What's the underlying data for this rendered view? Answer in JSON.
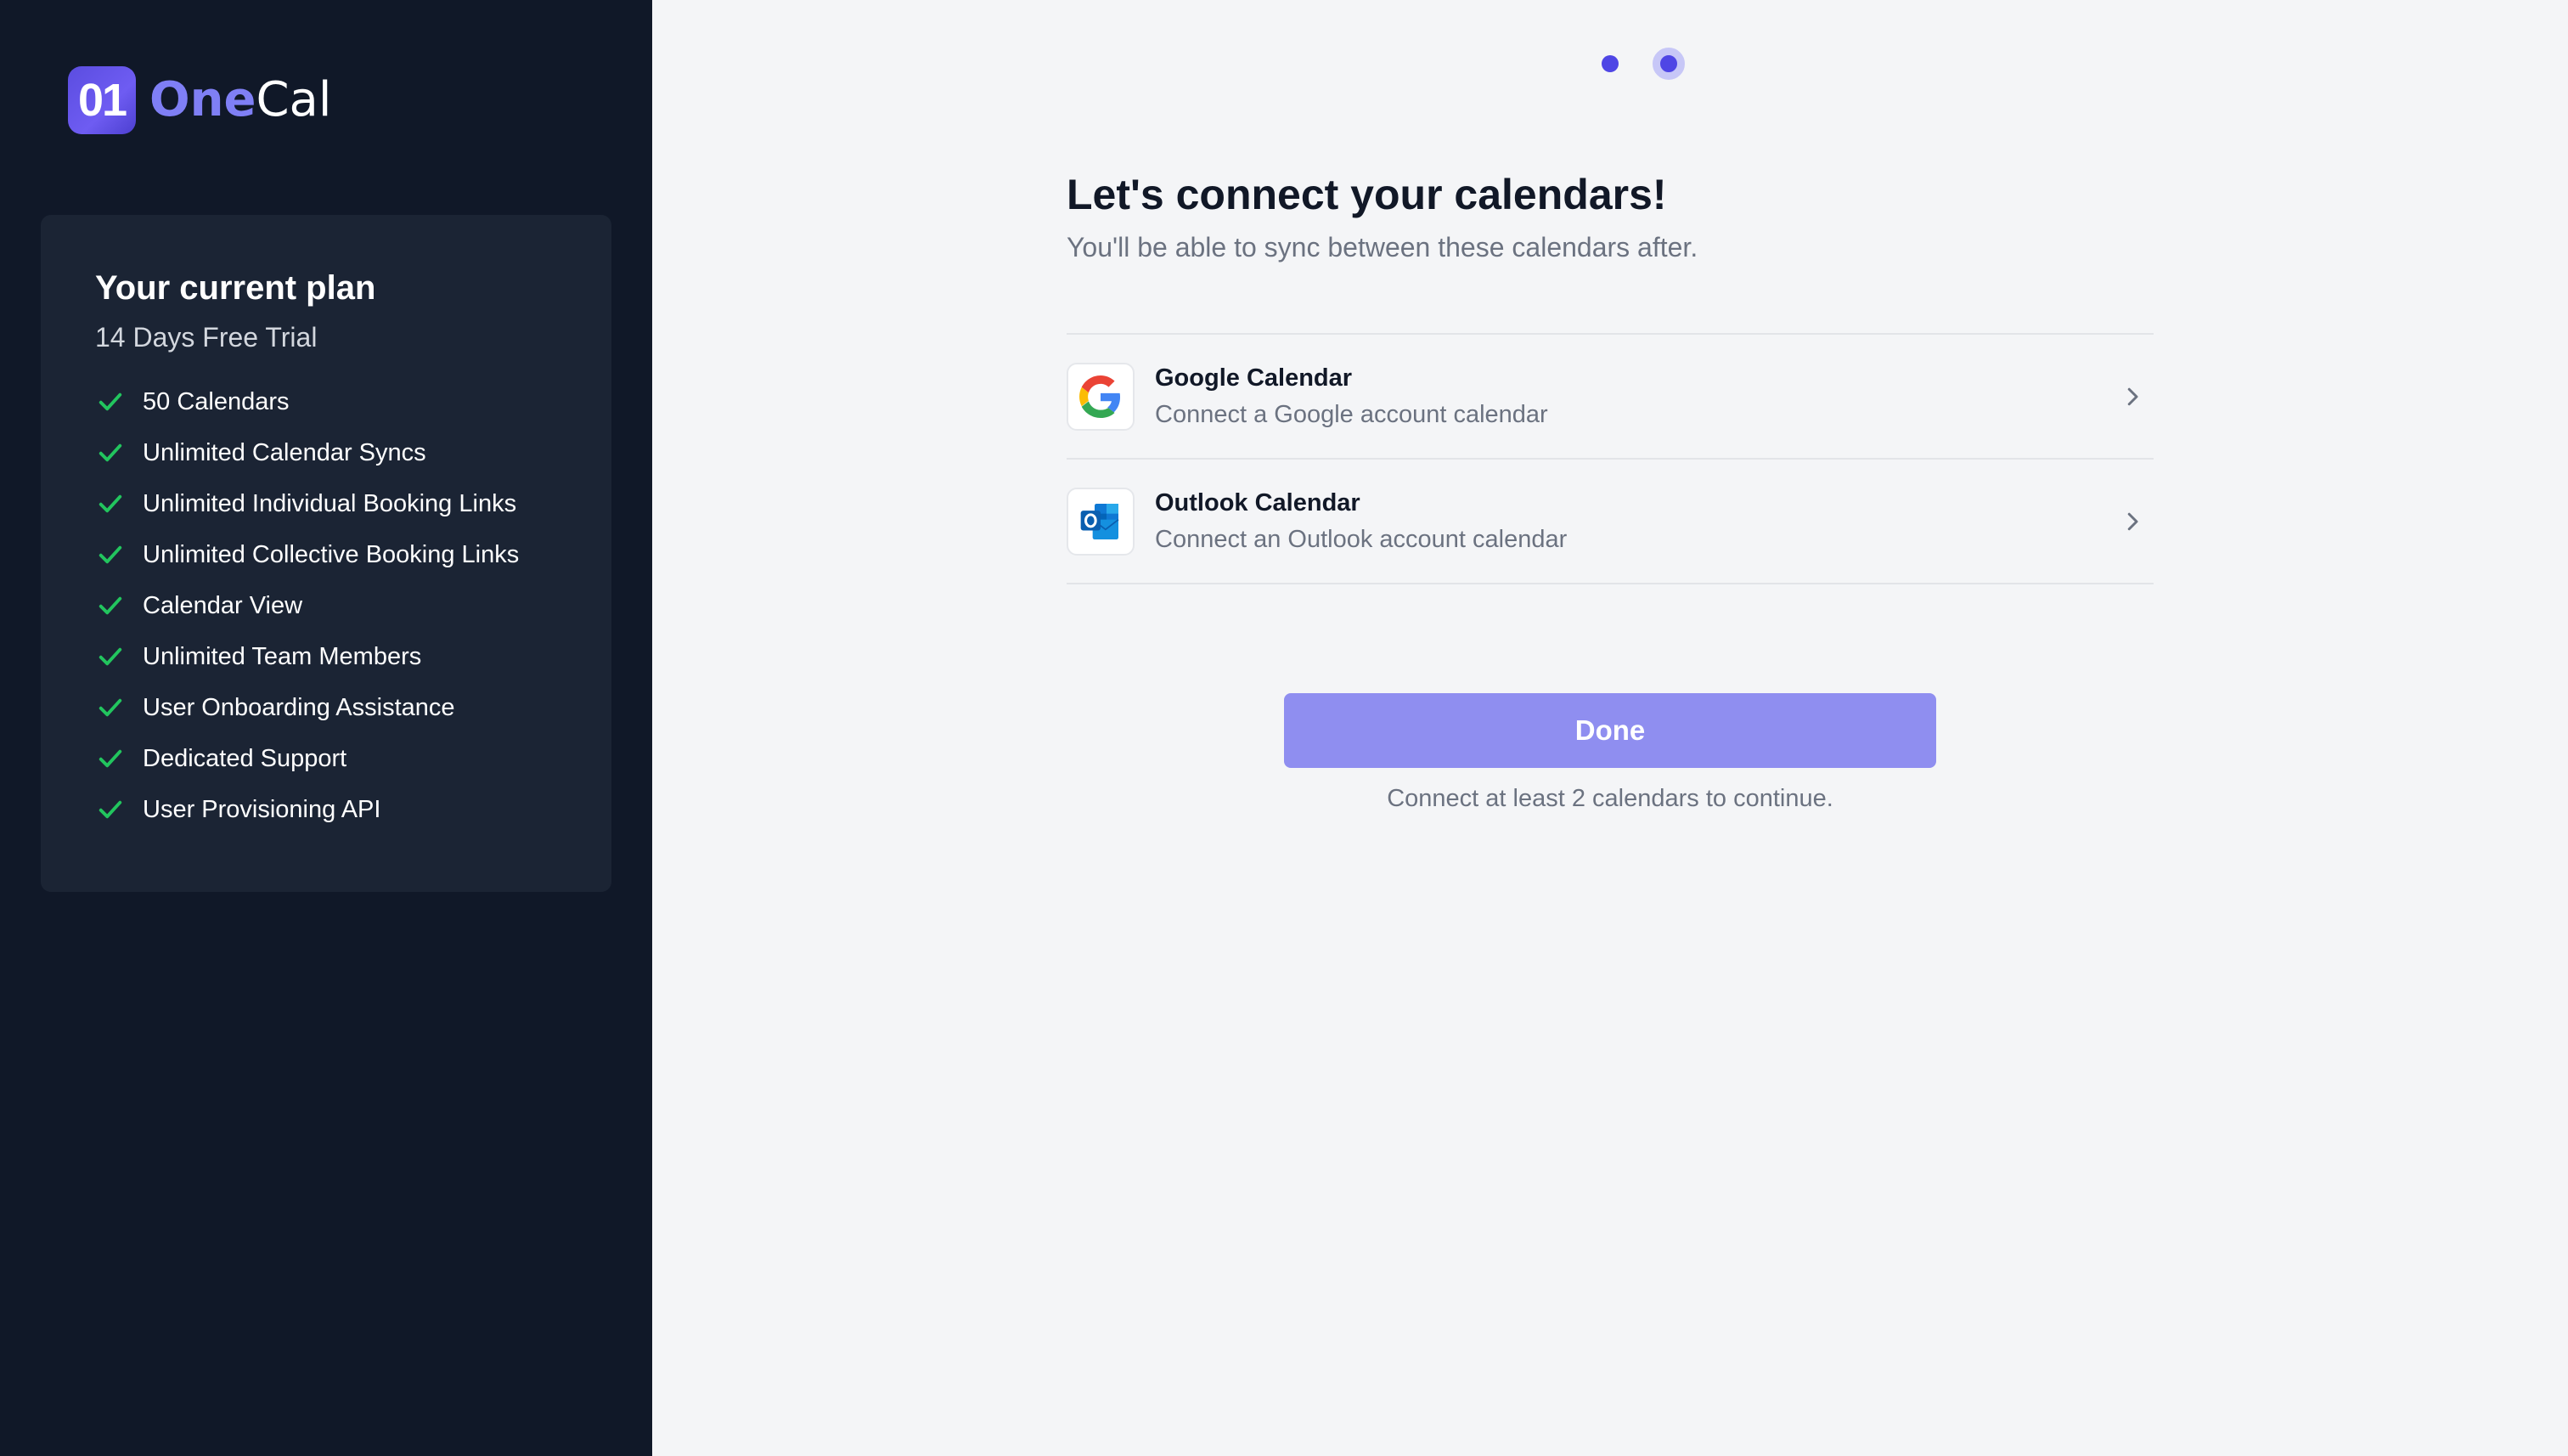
{
  "logo": {
    "badge": "01",
    "word_one": "One",
    "word_cal": "Cal"
  },
  "plan": {
    "title": "Your current plan",
    "subtitle": "14 Days Free Trial",
    "features": [
      "50 Calendars",
      "Unlimited Calendar Syncs",
      "Unlimited Individual Booking Links",
      "Unlimited Collective Booking Links",
      "Calendar View",
      "Unlimited Team Members",
      "User Onboarding Assistance",
      "Dedicated Support",
      "User Provisioning API"
    ]
  },
  "stepper": {
    "total_steps": 2,
    "current_step": 2
  },
  "main": {
    "heading": "Let's connect your calendars!",
    "subheading": "You'll be able to sync between these calendars after.",
    "providers": [
      {
        "name": "Google Calendar",
        "description": "Connect a Google account calendar",
        "icon": "google-icon"
      },
      {
        "name": "Outlook Calendar",
        "description": "Connect an Outlook account calendar",
        "icon": "outlook-icon"
      }
    ],
    "done_label": "Done",
    "done_hint": "Connect at least 2 calendars to continue."
  },
  "colors": {
    "sidebar_bg": "#101828",
    "card_bg": "#1b2434",
    "accent": "#4f46e5",
    "button_disabled": "#8f8ef0",
    "check": "#22c55e"
  }
}
